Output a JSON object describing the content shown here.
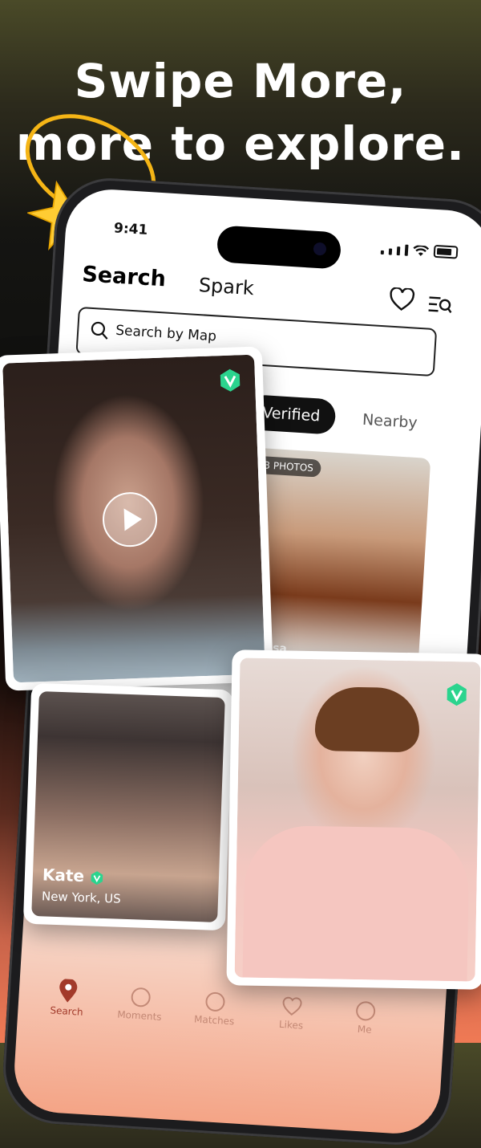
{
  "headline": {
    "line1": "Swipe More,",
    "line2": "more to explore."
  },
  "status": {
    "time": "9:41"
  },
  "header": {
    "tab_search": "Search",
    "tab_spark": "Spark"
  },
  "search": {
    "placeholder": "Search by Map"
  },
  "filters": {
    "verified": "Verified",
    "nearby": "Nearby"
  },
  "cards": {
    "featured_badge": "3 PHOTOS",
    "featured_name": "Teresa",
    "kate": {
      "name": "Kate",
      "location": "New York, US"
    }
  },
  "nav": {
    "search": "Search",
    "moments": "Moments",
    "matches": "Matches",
    "likes": "Likes",
    "me": "Me"
  },
  "colors": {
    "verified_green": "#2bd48e",
    "nav_active": "#a23a2a"
  }
}
